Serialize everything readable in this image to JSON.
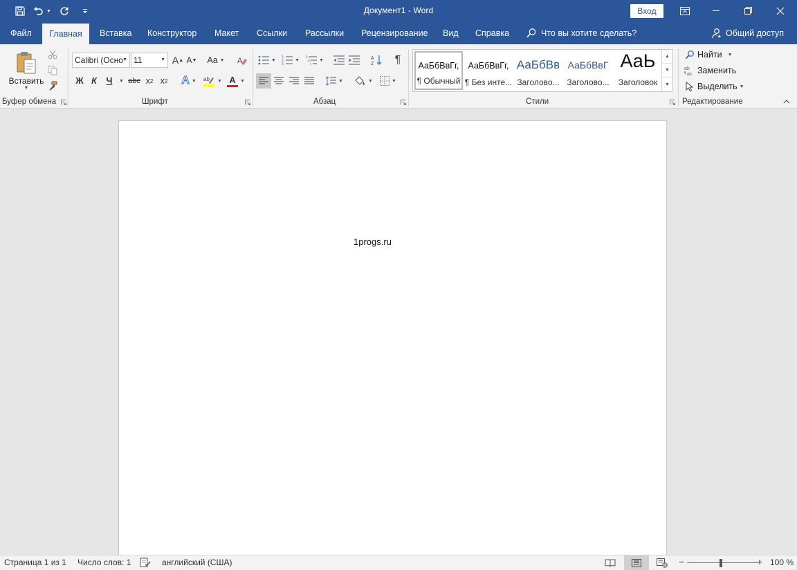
{
  "window": {
    "title": "Документ1  -  Word",
    "signin_label": "Вход"
  },
  "tabs": [
    {
      "label": "Файл"
    },
    {
      "label": "Главная"
    },
    {
      "label": "Вставка"
    },
    {
      "label": "Конструктор"
    },
    {
      "label": "Макет"
    },
    {
      "label": "Ссылки"
    },
    {
      "label": "Рассылки"
    },
    {
      "label": "Рецензирование"
    },
    {
      "label": "Вид"
    },
    {
      "label": "Справка"
    }
  ],
  "tellme": {
    "label": "Что вы хотите сделать?"
  },
  "share": {
    "label": "Общий доступ"
  },
  "ribbon": {
    "clipboard": {
      "group_label": "Буфер обмена",
      "paste_label": "Вставить"
    },
    "font": {
      "group_label": "Шрифт",
      "font_name": "Calibri (Осно",
      "font_size": "11",
      "bold": "Ж",
      "italic": "К",
      "underline": "Ч",
      "strike": "abc",
      "subscript": "x",
      "superscript": "x",
      "change_case": "Aa",
      "grow": "A",
      "shrink": "A",
      "font_color_letter": "A",
      "text_effects_letter": "A"
    },
    "paragraph": {
      "group_label": "Абзац"
    },
    "styles": {
      "group_label": "Стили",
      "items": [
        {
          "sample": "АаБбВвГг,",
          "name": "¶ Обычный"
        },
        {
          "sample": "АаБбВвГг,",
          "name": "¶ Без инте..."
        },
        {
          "sample": "АаБбВв",
          "name": "Заголово..."
        },
        {
          "sample": "АаБбВвГ",
          "name": "Заголово..."
        },
        {
          "sample": "АаЬ",
          "name": "Заголовок"
        }
      ]
    },
    "editing": {
      "group_label": "Редактирование",
      "find": "Найти",
      "replace": "Заменить",
      "select": "Выделить"
    }
  },
  "document": {
    "text": "1progs.ru"
  },
  "status": {
    "page": "Страница 1 из 1",
    "words": "Число слов: 1",
    "language": "английский (США)",
    "zoom": "100 %"
  },
  "colors": {
    "brand": "#2b579a",
    "highlight": "#ffff00",
    "font_color": "#e02020"
  }
}
